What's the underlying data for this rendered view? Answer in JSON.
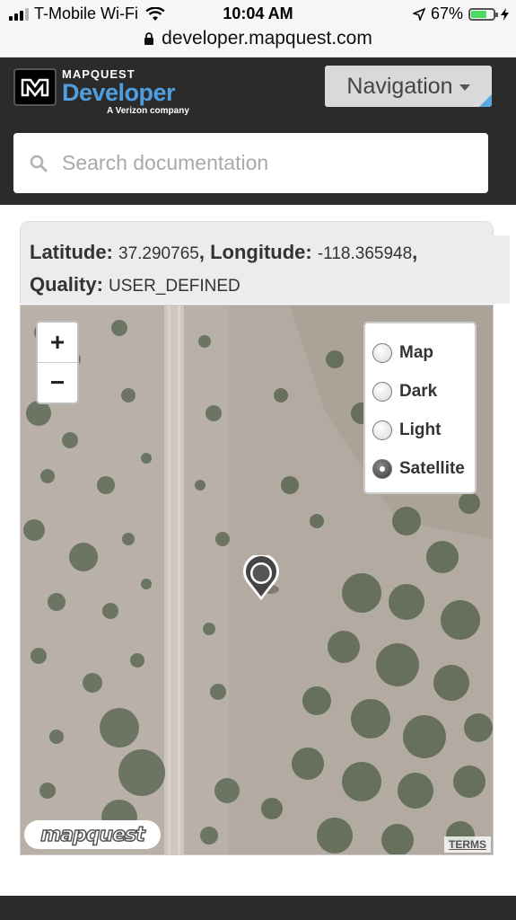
{
  "status_bar": {
    "carrier": "T-Mobile Wi-Fi",
    "time": "10:04 AM",
    "battery_percent": "67%",
    "battery_level": 0.67,
    "battery_color": "#4cd964"
  },
  "browser": {
    "url": "developer.mapquest.com",
    "lock_icon": "lock-icon"
  },
  "header": {
    "logo_brand": "MAPQUEST",
    "logo_product": "Developer",
    "logo_tagline": "A Verizon company",
    "nav_label": "Navigation",
    "accent": "#4f9fe0"
  },
  "search": {
    "placeholder": "Search documentation",
    "value": ""
  },
  "geocode_result": {
    "lat_label": "Latitude:",
    "lat_value": "37.290765",
    "lng_label": "Longitude:",
    "lng_value": "-118.365948",
    "quality_label": "Quality:",
    "quality_value": "USER_DEFINED"
  },
  "map": {
    "zoom_in": "+",
    "zoom_out": "−",
    "layers": [
      {
        "label": "Map",
        "selected": false
      },
      {
        "label": "Dark",
        "selected": false
      },
      {
        "label": "Light",
        "selected": false
      },
      {
        "label": "Satellite",
        "selected": true
      }
    ],
    "brand": "mapquest",
    "terms": "TERMS"
  }
}
